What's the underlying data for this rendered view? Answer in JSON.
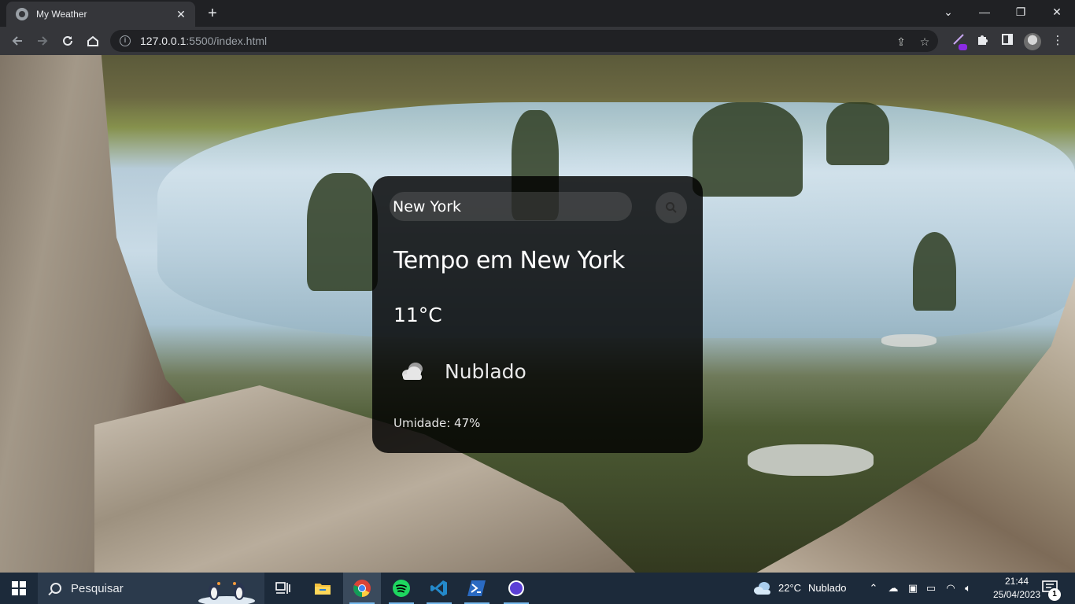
{
  "browser": {
    "tab_title": "My Weather",
    "tab_close": "✕",
    "new_tab": "+",
    "url_host": "127.0.0.1",
    "url_path": ":5500/index.html",
    "window_controls": {
      "tabs_dropdown": "⌄",
      "minimize": "—",
      "restore": "❐",
      "close": "✕"
    }
  },
  "weather": {
    "search_value": "New York",
    "title": "Tempo em New York",
    "temperature": "11°C",
    "condition": "Nublado",
    "humidity": "Umidade: 47%"
  },
  "taskbar": {
    "search_placeholder": "Pesquisar",
    "weather_temp": "22°C",
    "weather_condition": "Nublado",
    "time": "21:44",
    "date": "25/04/2023",
    "notification_count": "1"
  },
  "colors": {
    "card_bg": "#000000",
    "taskbar_bg": "#1c2a3a",
    "chrome_bg": "#202124",
    "toolbar_bg": "#35363a"
  },
  "icons": [
    "tab-globe-icon",
    "back-icon",
    "forward-icon",
    "reload-icon",
    "home-icon",
    "info-icon",
    "share-icon",
    "star-icon",
    "extension-icon",
    "puzzle-icon",
    "sidebar-icon",
    "profile-avatar",
    "search-icon",
    "cloud-icon",
    "windows-icon",
    "task-view-icon",
    "file-explorer-icon",
    "chrome-icon",
    "spotify-icon",
    "vscode-icon",
    "powershell-icon",
    "app-icon"
  ]
}
